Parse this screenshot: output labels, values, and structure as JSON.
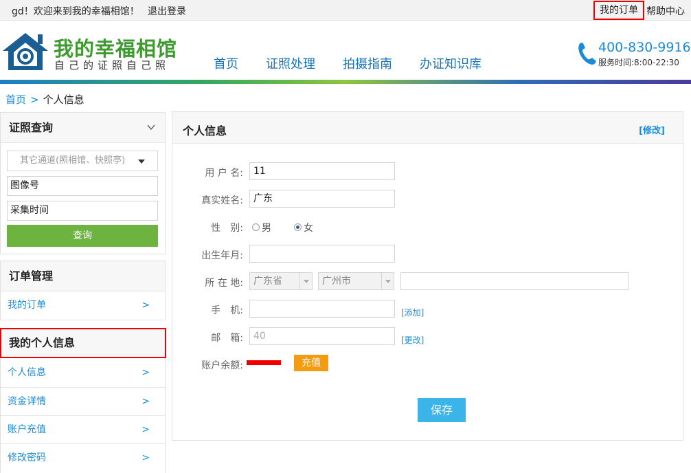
{
  "topbar": {
    "welcome": "gd！欢迎来到我的幸福相馆！",
    "logout": "退出登录",
    "my_orders": "我的订单",
    "help_center": "帮助中心"
  },
  "header": {
    "logo_title": "我的幸福相馆",
    "logo_subtitle": "自己的证照自己照",
    "nav": [
      "首页",
      "证照处理",
      "拍摄指南",
      "办证知识库"
    ],
    "phone": "400-830-9916",
    "service_hours": "服务时间:8:00-22:30",
    "colors": {
      "brand_green": "#3d9b2e",
      "link_blue": "#1a73ba"
    }
  },
  "breadcrumb": {
    "home": "首页",
    "separator": ">",
    "current": "个人信息"
  },
  "sidebar": {
    "query": {
      "title": "证照查询",
      "channel_select": "其它通道(照相馆、快照亭)",
      "image_no": "图像号",
      "capture_time": "采集时间",
      "query_button": "查询"
    },
    "orders": {
      "title": "订单管理",
      "items": [
        {
          "label": "我的订单",
          "arrow": ">"
        }
      ]
    },
    "profile": {
      "title": "我的个人信息",
      "items": [
        {
          "label": "个人信息",
          "arrow": ">"
        },
        {
          "label": "资金详情",
          "arrow": ">"
        },
        {
          "label": "账户充值",
          "arrow": ">"
        },
        {
          "label": "修改密码",
          "arrow": ">"
        }
      ]
    }
  },
  "main": {
    "title": "个人信息",
    "edit_link": "[修改]",
    "form": {
      "username_label": "用 户 名:",
      "username_value": "11",
      "realname_label": "真实姓名:",
      "realname_value": "广东",
      "gender_label": "性　别:",
      "gender_options": [
        "男",
        "女"
      ],
      "gender_selected": "女",
      "birth_label": "出生年月:",
      "birth_value": "",
      "address_label": "所 在 地:",
      "province": "广东省",
      "city": "广州市",
      "address_detail": "",
      "mobile_label": "手　机:",
      "mobile_value": "",
      "mobile_add": "[添加]",
      "email_label": "邮　箱:",
      "email_value": "40",
      "email_change": "[更改]",
      "balance_label": "账户余额:",
      "recharge_button": "充值",
      "save_button": "保存"
    }
  }
}
